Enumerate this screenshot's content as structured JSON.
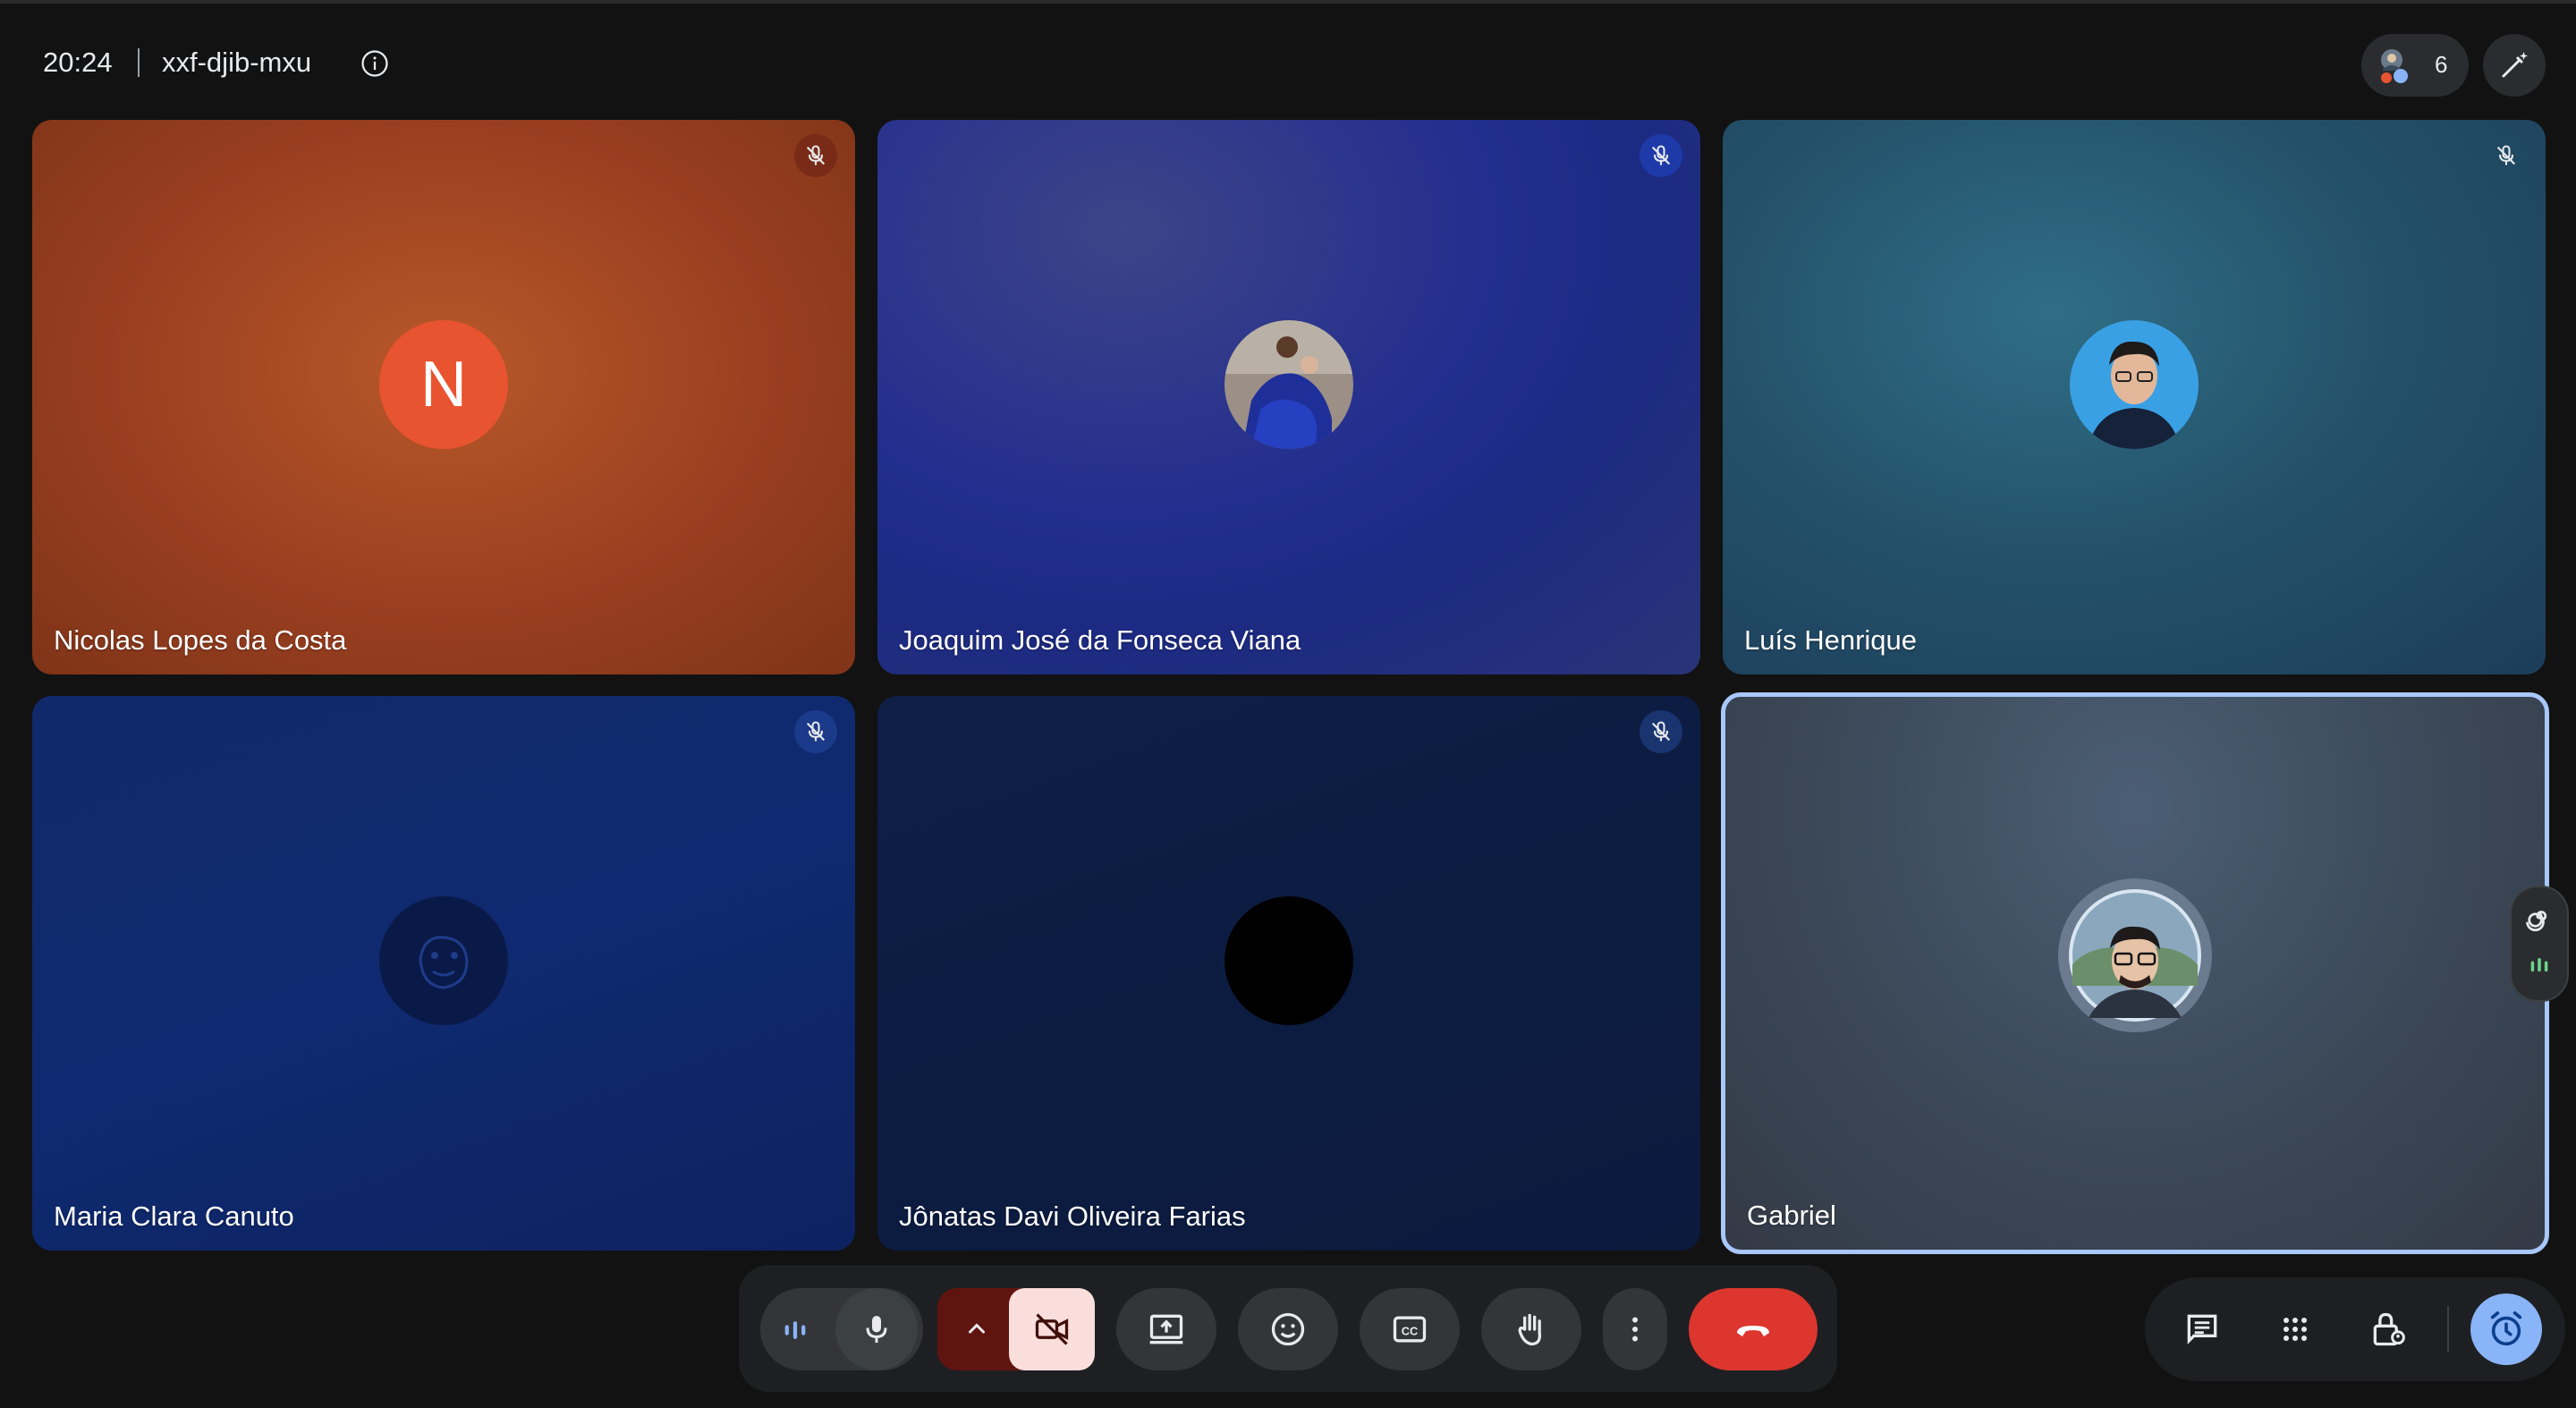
{
  "header": {
    "time": "20:24",
    "meeting_code": "xxf-djib-mxu",
    "participant_count": "6"
  },
  "participants": [
    {
      "name": "Nicolas Lopes da Costa",
      "initial": "N",
      "muted": true
    },
    {
      "name": "Joaquim José da Fonseca Viana",
      "muted": true
    },
    {
      "name": "Luís Henrique",
      "muted": true
    },
    {
      "name": "Maria Clara Canuto",
      "muted": true
    },
    {
      "name": "Jônatas Davi Oliveira Farias",
      "muted": true
    },
    {
      "name": "Gabriel",
      "muted": false,
      "active_speaker": true
    }
  ],
  "controls": {
    "icons": [
      "audio-level-icon",
      "microphone-icon",
      "chevron-up-icon",
      "camera-off-icon",
      "present-screen-icon",
      "emoji-icon",
      "captions-icon",
      "raise-hand-icon",
      "more-options-icon",
      "leave-call-icon"
    ],
    "camera_state": "off"
  },
  "side_panel": {
    "icons": [
      "chat-icon",
      "activities-icon",
      "host-controls-icon",
      "timer-icon"
    ]
  },
  "colors": {
    "accent": "#a8c7fa",
    "leave": "#dc362e",
    "camera_off_bg": "#f9dedc",
    "camera_off_outer": "#601410"
  }
}
